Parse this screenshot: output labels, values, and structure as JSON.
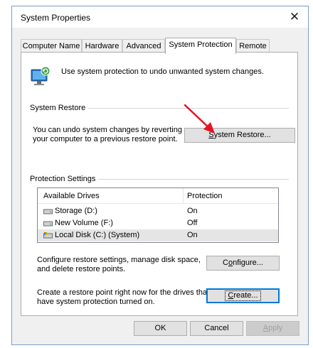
{
  "window": {
    "title": "System Properties",
    "close_glyph": "✕"
  },
  "tabs": [
    {
      "label": "Computer Name",
      "active": false
    },
    {
      "label": "Hardware",
      "active": false
    },
    {
      "label": "Advanced",
      "active": false
    },
    {
      "label": "System Protection",
      "active": true
    },
    {
      "label": "Remote",
      "active": false
    }
  ],
  "intro": {
    "icon": "system-protection-icon",
    "text": "Use system protection to undo unwanted system changes."
  },
  "system_restore": {
    "group_label": "System Restore",
    "description": [
      "You can undo system changes by reverting",
      "your computer to a previous restore point."
    ],
    "button_label_prefix": "",
    "button_label_underlined": "S",
    "button_label_rest": "ystem Restore...",
    "arrow_color": "#e81123"
  },
  "protection": {
    "group_label": "Protection Settings",
    "columns": [
      "Available Drives",
      "Protection"
    ],
    "drives": [
      {
        "name": "Storage (D:)",
        "protection": "On",
        "icon": "hard-drive-icon",
        "selected": false
      },
      {
        "name": "New Volume (F:)",
        "protection": "Off",
        "icon": "hard-drive-icon",
        "selected": false
      },
      {
        "name": "Local Disk (C:) (System)",
        "protection": "On",
        "icon": "system-drive-icon",
        "selected": true
      }
    ],
    "configure_text": [
      "Configure restore settings, manage disk space,",
      "and delete restore points."
    ],
    "configure_label_prefix": "C",
    "configure_label_underlined": "o",
    "configure_label_rest": "nfigure...",
    "create_text": [
      "Create a restore point right now for the drives that",
      "have system protection turned on."
    ],
    "create_label_prefix": "",
    "create_label_underlined": "C",
    "create_label_rest": "reate..."
  },
  "footer": {
    "ok_label": "OK",
    "cancel_label": "Cancel",
    "apply_label_underlined": "A",
    "apply_label_rest": "pply"
  },
  "colors": {
    "accent": "#0078d7",
    "window_border": "#7a9fc7"
  }
}
